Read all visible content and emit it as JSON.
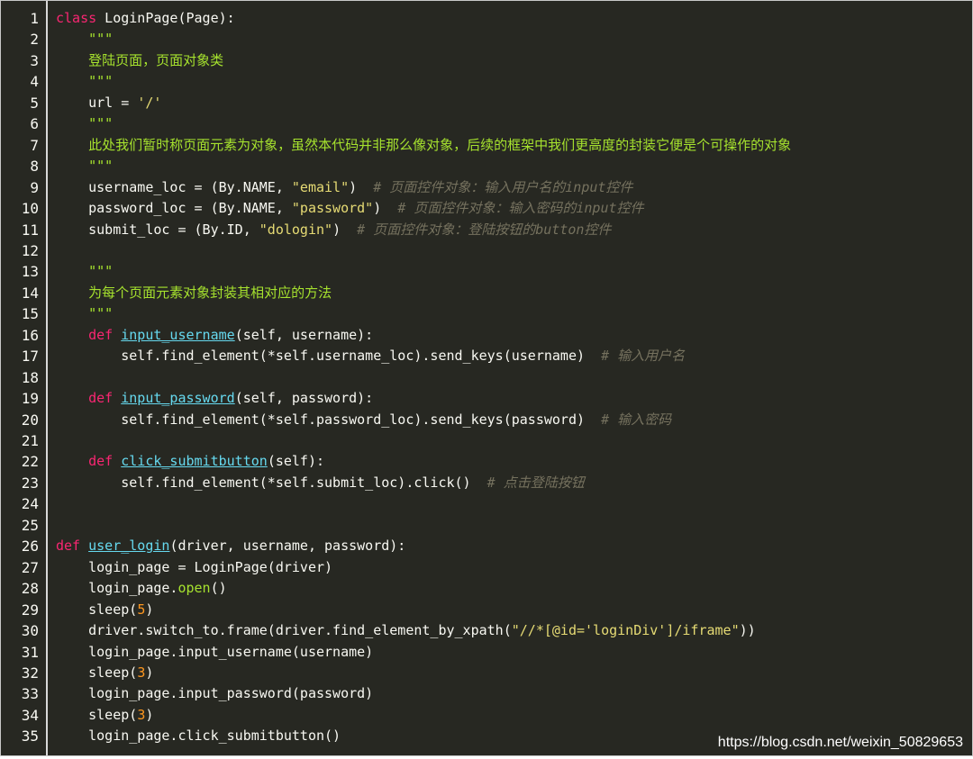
{
  "theme": {
    "background": "#272822",
    "default": "#f8f8f2",
    "keyword": "#f92672",
    "function": "#66d9ef",
    "string": "#e6db74",
    "comment": "#75715e",
    "number": "#fd971f",
    "docstring": "#a6e22e"
  },
  "lines": [
    {
      "n": "1",
      "tokens": [
        [
          "kw",
          "class"
        ],
        [
          "t",
          " LoginPage(Page):"
        ]
      ]
    },
    {
      "n": "2",
      "tokens": [
        [
          "t",
          "    "
        ],
        [
          "doc",
          "\"\"\""
        ]
      ]
    },
    {
      "n": "3",
      "tokens": [
        [
          "t",
          "    "
        ],
        [
          "doc",
          "登陆页面，页面对象类"
        ]
      ]
    },
    {
      "n": "4",
      "tokens": [
        [
          "t",
          "    "
        ],
        [
          "doc",
          "\"\"\""
        ]
      ]
    },
    {
      "n": "5",
      "tokens": [
        [
          "t",
          "    url "
        ],
        [
          "t",
          "="
        ],
        [
          "t",
          " "
        ],
        [
          "str",
          "'/'"
        ]
      ]
    },
    {
      "n": "6",
      "tokens": [
        [
          "t",
          "    "
        ],
        [
          "doc",
          "\"\"\""
        ]
      ]
    },
    {
      "n": "7",
      "tokens": [
        [
          "t",
          "    "
        ],
        [
          "doc",
          "此处我们暂时称页面元素为对象，虽然本代码并非那么像对象，后续的框架中我们更高度的封装它便是个可操作的对象"
        ]
      ]
    },
    {
      "n": "8",
      "tokens": [
        [
          "t",
          "    "
        ],
        [
          "doc",
          "\"\"\""
        ]
      ]
    },
    {
      "n": "9",
      "tokens": [
        [
          "t",
          "    username_loc = (By.NAME, "
        ],
        [
          "str",
          "\"email\""
        ],
        [
          "t",
          ")  "
        ],
        [
          "cm",
          "# 页面控件对象：输入用户名的input控件"
        ]
      ]
    },
    {
      "n": "10",
      "tokens": [
        [
          "t",
          "    password_loc = (By.NAME, "
        ],
        [
          "str",
          "\"password\""
        ],
        [
          "t",
          ")  "
        ],
        [
          "cm",
          "# 页面控件对象：输入密码的input控件"
        ]
      ]
    },
    {
      "n": "11",
      "tokens": [
        [
          "t",
          "    submit_loc = (By.ID, "
        ],
        [
          "str",
          "\"dologin\""
        ],
        [
          "t",
          ")  "
        ],
        [
          "cm",
          "# 页面控件对象：登陆按钮的button控件"
        ]
      ]
    },
    {
      "n": "12",
      "tokens": []
    },
    {
      "n": "13",
      "tokens": [
        [
          "t",
          "    "
        ],
        [
          "doc",
          "\"\"\""
        ]
      ]
    },
    {
      "n": "14",
      "tokens": [
        [
          "t",
          "    "
        ],
        [
          "doc",
          "为每个页面元素对象封装其相对应的方法"
        ]
      ]
    },
    {
      "n": "15",
      "tokens": [
        [
          "t",
          "    "
        ],
        [
          "doc",
          "\"\"\""
        ]
      ]
    },
    {
      "n": "16",
      "tokens": [
        [
          "t",
          "    "
        ],
        [
          "kw",
          "def"
        ],
        [
          "t",
          " "
        ],
        [
          "fn",
          "input_username"
        ],
        [
          "t",
          "(self, username):"
        ]
      ]
    },
    {
      "n": "17",
      "tokens": [
        [
          "t",
          "        self.find_element(*self.username_loc).send_keys(username)  "
        ],
        [
          "cm",
          "# 输入用户名"
        ]
      ]
    },
    {
      "n": "18",
      "tokens": []
    },
    {
      "n": "19",
      "tokens": [
        [
          "t",
          "    "
        ],
        [
          "kw",
          "def"
        ],
        [
          "t",
          " "
        ],
        [
          "fn",
          "input_password"
        ],
        [
          "t",
          "(self, password):"
        ]
      ]
    },
    {
      "n": "20",
      "tokens": [
        [
          "t",
          "        self.find_element(*self.password_loc).send_keys(password)  "
        ],
        [
          "cm",
          "# 输入密码"
        ]
      ]
    },
    {
      "n": "21",
      "tokens": []
    },
    {
      "n": "22",
      "tokens": [
        [
          "t",
          "    "
        ],
        [
          "kw",
          "def"
        ],
        [
          "t",
          " "
        ],
        [
          "fn",
          "click_submitbutton"
        ],
        [
          "t",
          "(self):"
        ]
      ]
    },
    {
      "n": "23",
      "tokens": [
        [
          "t",
          "        self.find_element(*self.submit_loc).click()  "
        ],
        [
          "cm",
          "# 点击登陆按钮"
        ]
      ]
    },
    {
      "n": "24",
      "tokens": []
    },
    {
      "n": "25",
      "tokens": []
    },
    {
      "n": "26",
      "tokens": [
        [
          "kw",
          "def"
        ],
        [
          "t",
          " "
        ],
        [
          "fn",
          "user_login"
        ],
        [
          "t",
          "(driver, username, password):"
        ]
      ]
    },
    {
      "n": "27",
      "tokens": [
        [
          "t",
          "    login_page = LoginPage(driver)"
        ]
      ]
    },
    {
      "n": "28",
      "tokens": [
        [
          "t",
          "    login_page."
        ],
        [
          "doc",
          "open"
        ],
        [
          "t",
          "()"
        ]
      ]
    },
    {
      "n": "29",
      "tokens": [
        [
          "t",
          "    sleep("
        ],
        [
          "num",
          "5"
        ],
        [
          "t",
          ")"
        ]
      ]
    },
    {
      "n": "30",
      "tokens": [
        [
          "t",
          "    driver.switch_to.frame(driver.find_element_by_xpath("
        ],
        [
          "str",
          "\"//*[@id='loginDiv']/iframe\""
        ],
        [
          "t",
          "))"
        ]
      ]
    },
    {
      "n": "31",
      "tokens": [
        [
          "t",
          "    login_page.input_username(username)"
        ]
      ]
    },
    {
      "n": "32",
      "tokens": [
        [
          "t",
          "    sleep("
        ],
        [
          "num",
          "3"
        ],
        [
          "t",
          ")"
        ]
      ]
    },
    {
      "n": "33",
      "tokens": [
        [
          "t",
          "    login_page.input_password(password)"
        ]
      ]
    },
    {
      "n": "34",
      "tokens": [
        [
          "t",
          "    sleep("
        ],
        [
          "num",
          "3"
        ],
        [
          "t",
          ")"
        ]
      ]
    },
    {
      "n": "35",
      "tokens": [
        [
          "t",
          "    login_page.click_submitbutton()"
        ]
      ]
    }
  ],
  "watermark": "https://blog.csdn.net/weixin_50829653"
}
